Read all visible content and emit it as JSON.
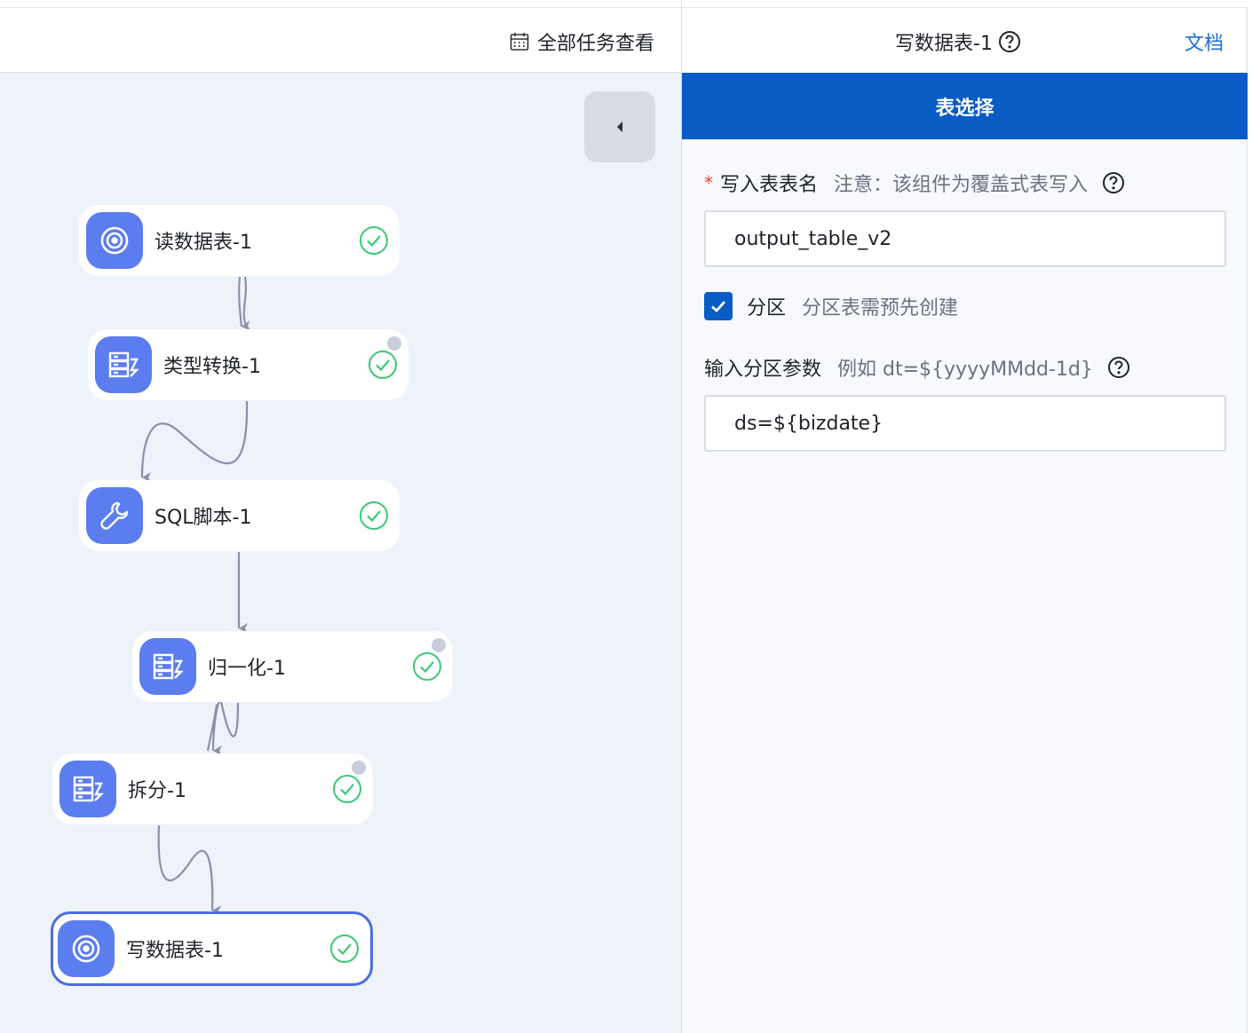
{
  "toolbar": {
    "all_tasks_label": "全部任务查看",
    "all_tasks_icon": "calendar-icon"
  },
  "graph": {
    "nodes": [
      {
        "id": "read",
        "label": "读数据表-1",
        "icon": "target-icon",
        "status": "success",
        "selected": false
      },
      {
        "id": "cast",
        "label": "类型转换-1",
        "icon": "table-transform-icon",
        "status": "success",
        "selected": false
      },
      {
        "id": "sql",
        "label": "SQL脚本-1",
        "icon": "wrench-icon",
        "status": "success",
        "selected": false
      },
      {
        "id": "norm",
        "label": "归一化-1",
        "icon": "table-transform-icon",
        "status": "success",
        "selected": false
      },
      {
        "id": "split",
        "label": "拆分-1",
        "icon": "table-transform-icon",
        "status": "success",
        "selected": false
      },
      {
        "id": "write",
        "label": "写数据表-1",
        "icon": "target-icon",
        "status": "success",
        "selected": true
      }
    ],
    "edges": [
      [
        "read",
        "cast"
      ],
      [
        "cast",
        "sql"
      ],
      [
        "sql",
        "norm"
      ],
      [
        "norm",
        "split"
      ],
      [
        "split",
        "write"
      ]
    ]
  },
  "panel": {
    "title": "写数据表-1",
    "docs_label": "文档",
    "tab_label": "表选择",
    "table_name": {
      "label": "写入表表名",
      "hint": "注意：该组件为覆盖式表写入",
      "value": "output_table_v2"
    },
    "partition": {
      "checked": true,
      "label": "分区",
      "hint": "分区表需预先创建"
    },
    "partition_param": {
      "label": "输入分区参数",
      "hint": "例如 dt=${yyyyMMdd-1d}",
      "value": "ds=${bizdate}"
    }
  },
  "colors": {
    "primary": "#0a5bc4",
    "node_icon": "#5b7def",
    "success": "#3cc878",
    "canvas_bg": "#eef2f9",
    "edge": "#8a90a8",
    "required": "#e5483b"
  }
}
